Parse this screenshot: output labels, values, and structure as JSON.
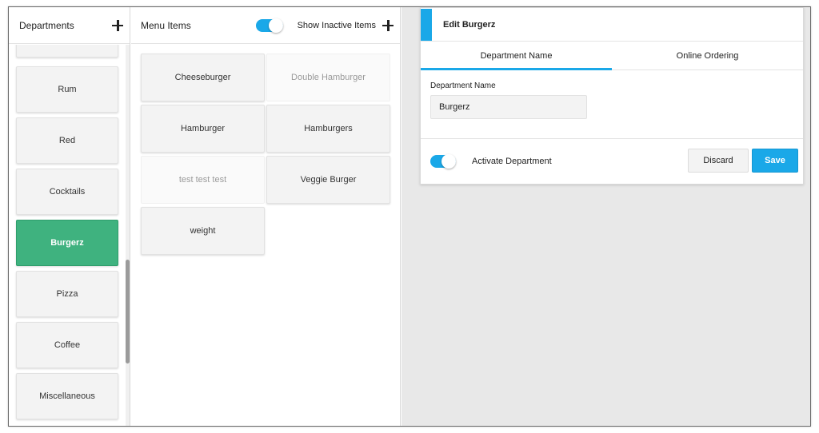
{
  "departments": {
    "title": "Departments",
    "items": [
      "",
      "Rum",
      "Red",
      "Cocktails",
      "Burgerz",
      "Pizza",
      "Coffee",
      "Miscellaneous"
    ],
    "active": "Burgerz"
  },
  "menu": {
    "title": "Menu Items",
    "show_inactive_label": "Show Inactive Items",
    "show_inactive_on": true,
    "items": [
      {
        "label": "Cheeseburger",
        "inactive": false
      },
      {
        "label": "Double Hamburger",
        "inactive": true
      },
      {
        "label": "Hamburger",
        "inactive": false
      },
      {
        "label": "Hamburgers",
        "inactive": false
      },
      {
        "label": "test test test",
        "inactive": true
      },
      {
        "label": "Veggie Burger",
        "inactive": false
      },
      {
        "label": "weight",
        "inactive": false
      }
    ]
  },
  "edit": {
    "title": "Edit Burgerz",
    "tabs": [
      "Department Name",
      "Online Ordering"
    ],
    "active_tab": "Department Name",
    "field_label": "Department Name",
    "field_value": "Burgerz",
    "activate_label": "Activate Department",
    "activate_on": true,
    "discard_label": "Discard",
    "save_label": "Save"
  },
  "colors": {
    "accent": "#1aa8e8",
    "active_department": "#3fb27f"
  }
}
